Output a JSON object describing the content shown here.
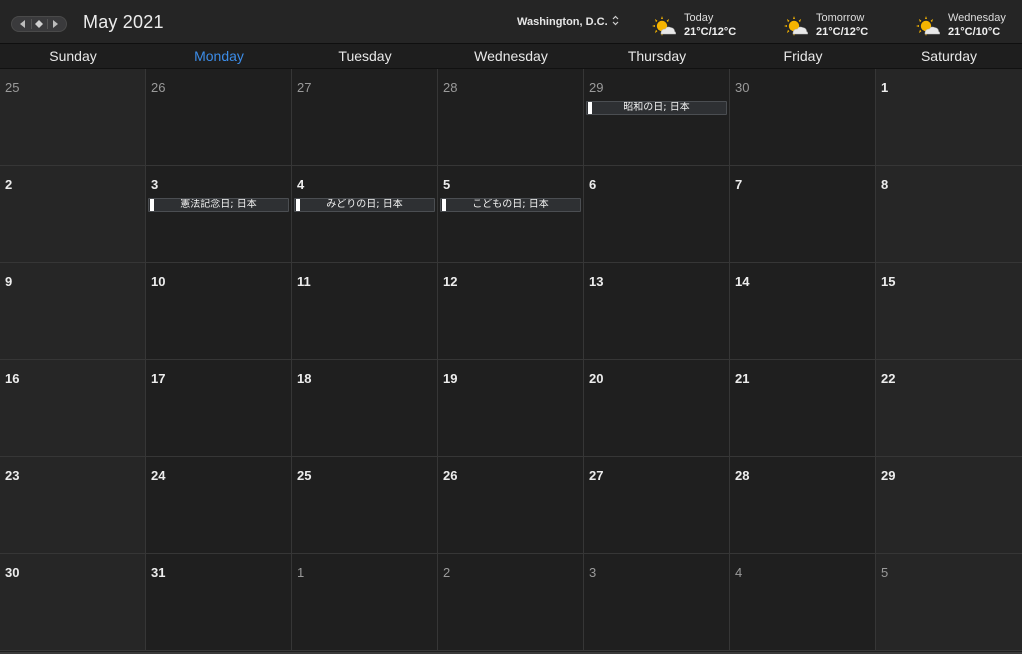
{
  "toolbar": {
    "title": "May 2021",
    "location": "Washington, D.C.",
    "weather": [
      {
        "day": "Today",
        "temp": "21°C/12°C",
        "icon": "sun-cloud-icon"
      },
      {
        "day": "Tomorrow",
        "temp": "21°C/12°C",
        "icon": "sun-cloud-icon"
      },
      {
        "day": "Wednesday",
        "temp": "21°C/10°C",
        "icon": "sun-cloud-icon"
      }
    ]
  },
  "weekdays": [
    "Sunday",
    "Monday",
    "Tuesday",
    "Wednesday",
    "Thursday",
    "Friday",
    "Saturday"
  ],
  "today_weekday_index": 1,
  "colors": {
    "today_accent": "#3c8ce7",
    "event_bar": "#ffffff"
  },
  "weeks": [
    [
      {
        "day": "25",
        "current": false
      },
      {
        "day": "26",
        "current": false
      },
      {
        "day": "27",
        "current": false
      },
      {
        "day": "28",
        "current": false
      },
      {
        "day": "29",
        "current": false,
        "event": "昭和の日; 日本"
      },
      {
        "day": "30",
        "current": false
      },
      {
        "day": "1",
        "current": true
      }
    ],
    [
      {
        "day": "2",
        "current": true
      },
      {
        "day": "3",
        "current": true,
        "event": "憲法記念日; 日本"
      },
      {
        "day": "4",
        "current": true,
        "event": "みどりの日; 日本"
      },
      {
        "day": "5",
        "current": true,
        "event": "こどもの日; 日本"
      },
      {
        "day": "6",
        "current": true
      },
      {
        "day": "7",
        "current": true
      },
      {
        "day": "8",
        "current": true
      }
    ],
    [
      {
        "day": "9",
        "current": true
      },
      {
        "day": "10",
        "current": true
      },
      {
        "day": "11",
        "current": true
      },
      {
        "day": "12",
        "current": true
      },
      {
        "day": "13",
        "current": true
      },
      {
        "day": "14",
        "current": true
      },
      {
        "day": "15",
        "current": true
      }
    ],
    [
      {
        "day": "16",
        "current": true
      },
      {
        "day": "17",
        "current": true
      },
      {
        "day": "18",
        "current": true
      },
      {
        "day": "19",
        "current": true
      },
      {
        "day": "20",
        "current": true
      },
      {
        "day": "21",
        "current": true
      },
      {
        "day": "22",
        "current": true
      }
    ],
    [
      {
        "day": "23",
        "current": true
      },
      {
        "day": "24",
        "current": true
      },
      {
        "day": "25",
        "current": true
      },
      {
        "day": "26",
        "current": true
      },
      {
        "day": "27",
        "current": true
      },
      {
        "day": "28",
        "current": true
      },
      {
        "day": "29",
        "current": true
      }
    ],
    [
      {
        "day": "30",
        "current": true
      },
      {
        "day": "31",
        "current": true
      },
      {
        "day": "1",
        "current": false
      },
      {
        "day": "2",
        "current": false
      },
      {
        "day": "3",
        "current": false
      },
      {
        "day": "4",
        "current": false
      },
      {
        "day": "5",
        "current": false
      }
    ]
  ]
}
